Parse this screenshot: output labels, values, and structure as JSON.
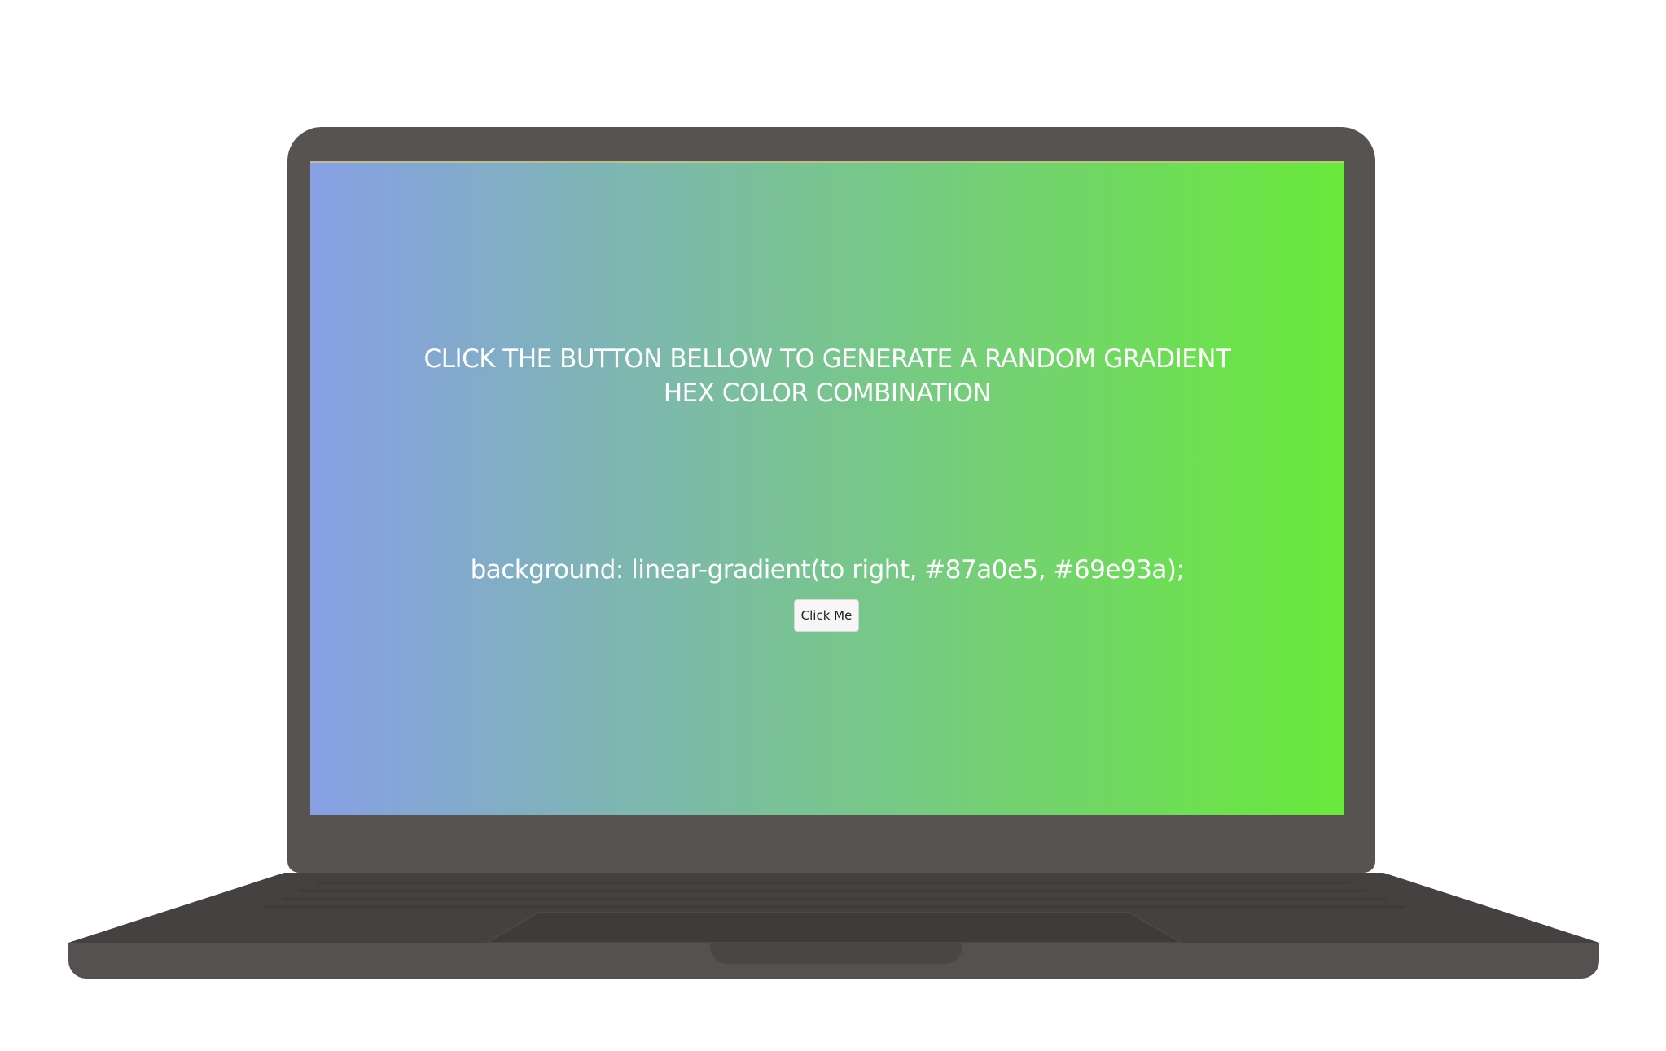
{
  "app": {
    "heading_line1": "CLICK THE BUTTON BELLOW TO GENERATE A RANDOM GRADIENT",
    "heading_line2": "HEX COLOR COMBINATION",
    "css_output": "background: linear-gradient(to right, #87a0e5, #69e93a);",
    "button_label": "Click Me"
  },
  "colors": {
    "gradient_start": "#87a0e5",
    "gradient_end": "#69e93a",
    "laptop_body": "#575351",
    "text": "#ffffff"
  },
  "icons": {
    "device": "laptop-icon"
  }
}
